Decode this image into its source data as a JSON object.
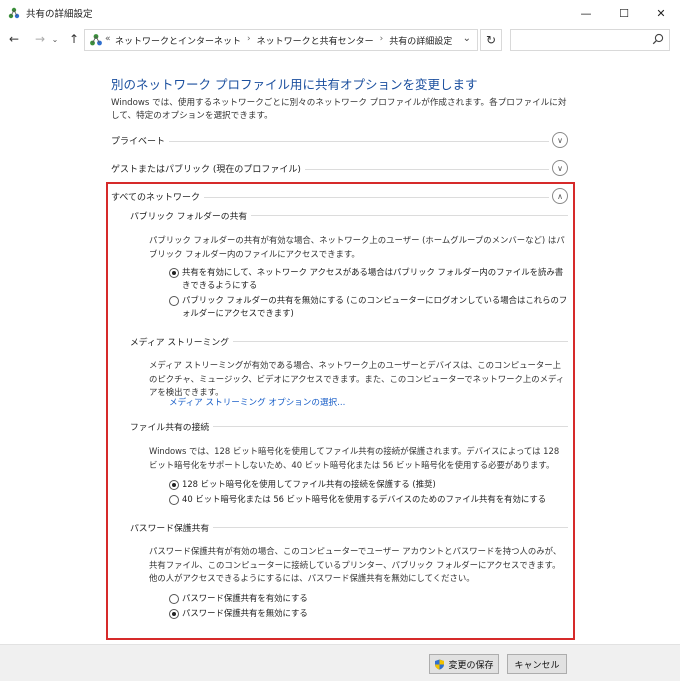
{
  "window": {
    "title": "共有の詳細設定",
    "minimize_glyph": "—",
    "maximize_glyph": "☐",
    "close_glyph": "✕"
  },
  "nav": {
    "back_glyph": "←",
    "forward_glyph": "→",
    "recent_glyph": "⌄",
    "up_glyph": "↑",
    "breadcrumb_prefix": "«",
    "breadcrumbs": [
      "ネットワークとインターネット",
      "ネットワークと共有センター",
      "共有の詳細設定"
    ],
    "breadcrumb_separator": "›",
    "dropdown_glyph": "⌄",
    "refresh_glyph": "↻",
    "search_placeholder": ""
  },
  "main": {
    "heading": "別のネットワーク プロファイル用に共有オプションを変更します",
    "intro": "Windows では、使用するネットワークごとに別々のネットワーク プロファイルが作成されます。各プロファイルに対して、特定のオプションを選択できます。",
    "profiles": [
      {
        "label": "プライベート",
        "chevron": "∨"
      },
      {
        "label": "ゲストまたはパブリック (現在のプロファイル)",
        "chevron": "∨"
      },
      {
        "label": "すべてのネットワーク",
        "chevron": "∧"
      }
    ],
    "public_folder": {
      "title": "パブリック フォルダーの共有",
      "description": "パブリック フォルダーの共有が有効な場合、ネットワーク上のユーザー (ホームグループのメンバーなど) はパブリック フォルダー内のファイルにアクセスできます。",
      "options": [
        {
          "label": "共有を有効にして、ネットワーク アクセスがある場合はパブリック フォルダー内のファイルを読み書きできるようにする",
          "checked": true
        },
        {
          "label": "パブリック フォルダーの共有を無効にする (このコンピューターにログオンしている場合はこれらのフォルダーにアクセスできます)",
          "checked": false
        }
      ]
    },
    "media_streaming": {
      "title": "メディア ストリーミング",
      "description": "メディア ストリーミングが有効である場合、ネットワーク上のユーザーとデバイスは、このコンピューター上のピクチャ、ミュージック、ビデオにアクセスできます。また、このコンピューターでネットワーク上のメディアを検出できます。",
      "link": "メディア ストリーミング オプションの選択..."
    },
    "file_sharing": {
      "title": "ファイル共有の接続",
      "description": "Windows では、128 ビット暗号化を使用してファイル共有の接続が保護されます。デバイスによっては 128 ビット暗号化をサポートしないため、40 ビット暗号化または 56 ビット暗号化を使用する必要があります。",
      "options": [
        {
          "label": "128 ビット暗号化を使用してファイル共有の接続を保護する (推奨)",
          "checked": true
        },
        {
          "label": "40 ビット暗号化または 56 ビット暗号化を使用するデバイスのためのファイル共有を有効にする",
          "checked": false
        }
      ]
    },
    "password_sharing": {
      "title": "パスワード保護共有",
      "description": "パスワード保護共有が有効の場合、このコンピューターでユーザー アカウントとパスワードを持つ人のみが、共有ファイル、このコンピューターに接続しているプリンター、パブリック フォルダーにアクセスできます。他の人がアクセスできるようにするには、パスワード保護共有を無効にしてください。",
      "options": [
        {
          "label": "パスワード保護共有を有効にする",
          "checked": false
        },
        {
          "label": "パスワード保護共有を無効にする",
          "checked": true
        }
      ]
    }
  },
  "footer": {
    "save_label": "変更の保存",
    "cancel_label": "キャンセル"
  },
  "colors": {
    "heading": "#1b4f9e",
    "link": "#1a5fc8",
    "highlight_border": "#d62a2a"
  }
}
